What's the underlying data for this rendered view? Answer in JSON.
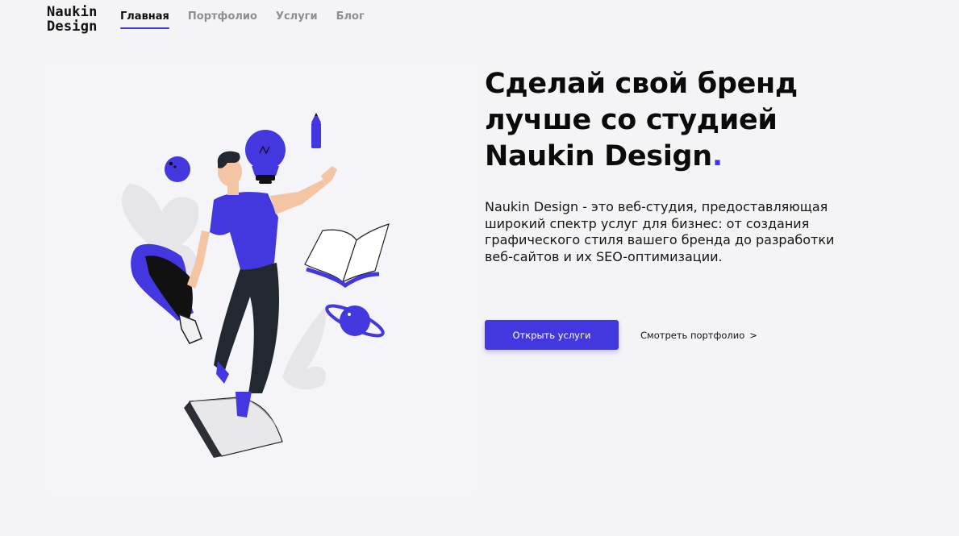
{
  "header": {
    "logo_line1": "Naukin",
    "logo_line2": "Design",
    "nav": [
      {
        "label": "Главная",
        "active": true
      },
      {
        "label": "Портфолио",
        "active": false
      },
      {
        "label": "Услуги",
        "active": false
      },
      {
        "label": "Блог",
        "active": false
      }
    ]
  },
  "hero": {
    "title_line1": "Сделай свой бренд",
    "title_line2": "лучше со студией",
    "title_line3": "Naukin Design",
    "title_dot": ".",
    "description": "Naukin Design - это веб-студия, предоставляющая широкий спектр услуг для бизнес: от создания графического стиля вашего бренда до разработки веб-сайтов и их SEO-оптимизации.",
    "primary_button": "Открыть услуги",
    "secondary_link": "Смотреть портфолио",
    "secondary_chevron": ">"
  },
  "colors": {
    "accent": "#4338e0",
    "background": "#f4f3f5",
    "text": "#0a0a0a"
  },
  "illustration": {
    "subject": "man floating with lightbulb, pencil, book, planet, bowling ball, notebook and leaves"
  }
}
